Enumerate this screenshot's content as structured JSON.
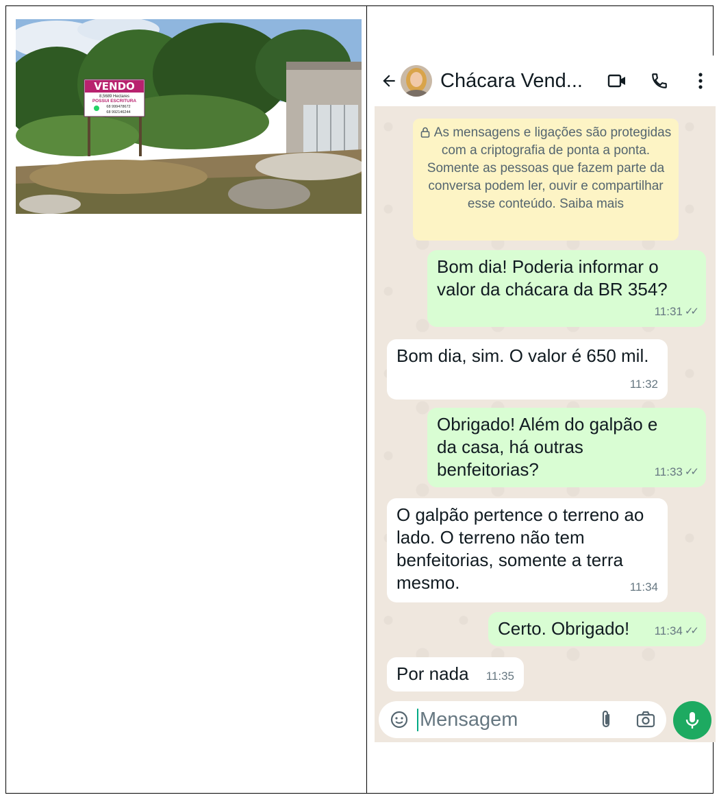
{
  "photo": {
    "sign": {
      "title": "VENDO",
      "line1": "8,5689 Hectares",
      "line2": "POSSUI ESCRITURA",
      "phone1": "68 999478672",
      "phone2": "68 992146244"
    }
  },
  "chat": {
    "title": "Chácara Vend...",
    "encryption_notice": "As mensagens e ligações são protegidas com a criptografia de ponta a ponta. Somente as pessoas que fazem parte da conversa podem ler, ouvir e compartilhar esse conteúdo. Saiba mais",
    "messages": [
      {
        "direction": "out",
        "text": "Bom dia! Poderia informar o valor da chácara da BR 354?",
        "time": "11:31",
        "read": true
      },
      {
        "direction": "in",
        "text": "Bom dia, sim. O valor é 650 mil.",
        "time": "11:32"
      },
      {
        "direction": "out",
        "text": "Obrigado! Além do galpão e da casa, há outras benfeitorias?",
        "time": "11:33",
        "read": true
      },
      {
        "direction": "in",
        "text": "O galpão pertence o terreno ao lado. O terreno não tem benfeitorias, somente a terra mesmo.",
        "time": "11:34"
      },
      {
        "direction": "out",
        "text": "Certo. Obrigado!",
        "time": "11:34",
        "read": true
      },
      {
        "direction": "in",
        "text": "Por nada",
        "time": "11:35"
      }
    ],
    "input": {
      "placeholder": "Mensagem",
      "value": ""
    }
  },
  "colors": {
    "outgoing_bubble": "#d9fdd3",
    "incoming_bubble": "#ffffff",
    "accent": "#1daa61",
    "notice_bg": "#fdf4c5"
  }
}
